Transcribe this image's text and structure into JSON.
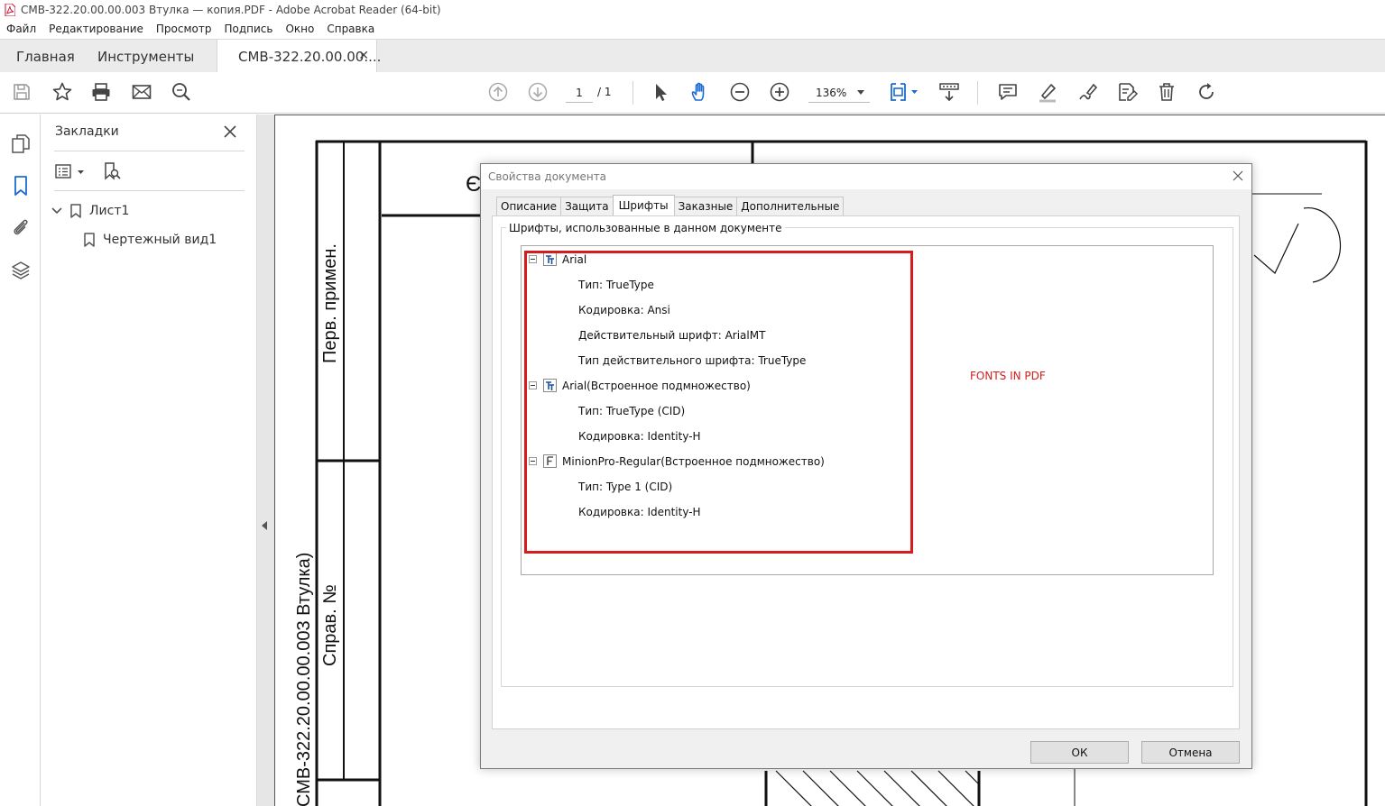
{
  "window": {
    "title": "СМВ-322.20.00.00.003 Втулка — копия.PDF - Adobe Acrobat Reader (64-bit)"
  },
  "menu": [
    "Файл",
    "Редактирование",
    "Просмотр",
    "Подпись",
    "Окно",
    "Справка"
  ],
  "tabs": {
    "home": "Главная",
    "tools": "Инструменты",
    "document": "СМВ-322.20.00.00...."
  },
  "toolbar": {
    "page_current": "1",
    "page_total": "/ 1",
    "zoom": "136%"
  },
  "bookmarks": {
    "title": "Закладки",
    "items": [
      {
        "label": "Лист1",
        "level": 0,
        "expanded": true
      },
      {
        "label": "Чертежный вид1",
        "level": 1
      }
    ]
  },
  "drawing": {
    "label_first_use": "Перв. примен.",
    "label_ref_no": "Справ. №",
    "label_designation": "СМВ-322.20.00.00.003 Втулка)",
    "fragment_char": "Є"
  },
  "dialog": {
    "title": "Свойства документа",
    "tabs": [
      "Описание",
      "Защита",
      "Шрифты",
      "Заказные",
      "Дополнительные"
    ],
    "active_tab": "Шрифты",
    "group_label": "Шрифты, использованные в данном документе",
    "fonts": [
      {
        "name": "Arial",
        "icon": "truetype-font-icon",
        "details": [
          "Тип: TrueType",
          "Кодировка: Ansi",
          "Действительный шрифт: ArialMT",
          "Тип действительного шрифта: TrueType"
        ]
      },
      {
        "name": "Arial(Встроенное подмножество)",
        "icon": "truetype-font-icon",
        "details": [
          "Тип: TrueType (CID)",
          "Кодировка: Identity-H"
        ]
      },
      {
        "name": "MinionPro-Regular(Встроенное подмножество)",
        "icon": "type1-font-icon",
        "details": [
          "Тип: Type 1 (CID)",
          "Кодировка: Identity-H"
        ]
      }
    ],
    "annotation": "FONTS IN PDF",
    "annotation_color": "#d51d1d",
    "ok_label": "ОК",
    "cancel_label": "Отмена"
  }
}
